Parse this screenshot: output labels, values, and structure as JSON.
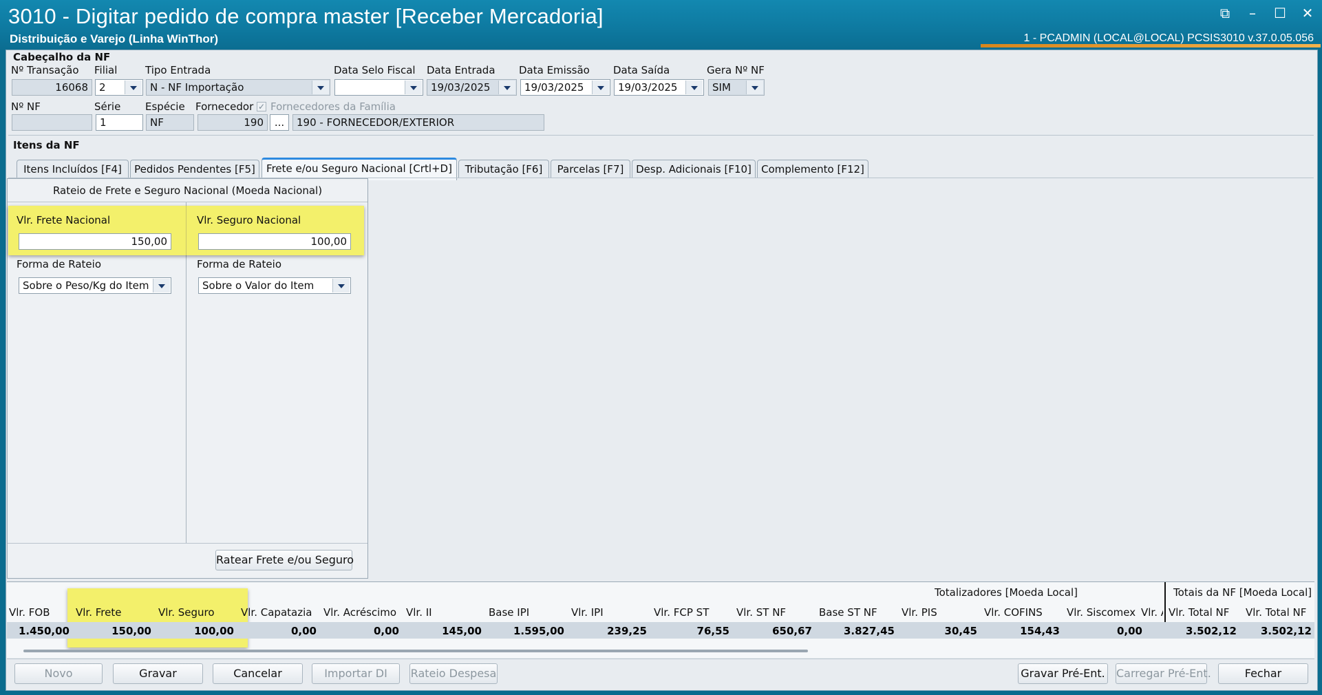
{
  "window": {
    "title": "3010 - Digitar pedido de compra master [Receber Mercadoria]",
    "subtitle": "Distribuição e Varejo (Linha WinThor)",
    "userinfo": "1 - PCADMIN (LOCAL@LOCAL)   PCSIS3010  v.37.0.05.056",
    "controls": [
      "external-icon",
      "minimize-icon",
      "maximize-icon",
      "close-icon"
    ]
  },
  "header": {
    "section_title": "Cabeçalho da NF",
    "n_transacao_label": "Nº Transação",
    "n_transacao": "16068",
    "filial_label": "Filial",
    "filial": "2",
    "tipo_entrada_label": "Tipo Entrada",
    "tipo_entrada": "N - NF Importação",
    "data_selo_label": "Data Selo Fiscal",
    "data_selo": "",
    "data_entrada_label": "Data Entrada",
    "data_entrada": "19/03/2025",
    "data_emissao_label": "Data Emissão",
    "data_emissao": "19/03/2025",
    "data_saida_label": "Data Saída",
    "data_saida": "19/03/2025",
    "gera_nf_label": "Gera Nº NF",
    "gera_nf": "SIM",
    "n_nf_label": "Nº NF",
    "n_nf": "",
    "serie_label": "Série",
    "serie": "1",
    "especie_label": "Espécie",
    "especie": "NF",
    "fornecedor_label": "Fornecedor",
    "fornecedor_code": "190",
    "fornecedor_name": "190 - FORNECEDOR/EXTERIOR",
    "fornecedores_familia_label": "Fornecedores da Família",
    "lookup_label": "..."
  },
  "itens": {
    "section_title": "Itens da NF",
    "tabs": [
      {
        "label": "Itens Incluídos [F4]"
      },
      {
        "label": "Pedidos Pendentes [F5]"
      },
      {
        "label": "Frete e/ou Seguro Nacional [Crtl+D]"
      },
      {
        "label": "Tributação [F6]"
      },
      {
        "label": "Parcelas [F7]"
      },
      {
        "label": "Desp. Adicionais [F10]"
      },
      {
        "label": "Complemento [F12]"
      }
    ]
  },
  "rateio": {
    "panel_title": "Rateio de Frete e Seguro Nacional (Moeda Nacional)",
    "frete_label": "Vlr. Frete Nacional",
    "frete_value": "150,00",
    "seguro_label": "Vlr. Seguro Nacional",
    "seguro_value": "100,00",
    "forma_label_1": "Forma de Rateio",
    "forma_value_1": "Sobre o Peso/Kg do Item",
    "forma_label_2": "Forma de Rateio",
    "forma_value_2": "Sobre o Valor do Item",
    "ratear_button": "Ratear Frete e/ou Seguro"
  },
  "totals": {
    "group_label": "Totalizadores [Moeda Local]",
    "group_label_2": "Totais da NF [Moeda Local]",
    "columns": [
      {
        "label": "Vlr. FOB",
        "value": "1.450,00"
      },
      {
        "label": "Vlr. Frete",
        "value": "150,00"
      },
      {
        "label": "Vlr. Seguro",
        "value": "100,00"
      },
      {
        "label": "Vlr. Capatazia",
        "value": "0,00"
      },
      {
        "label": "Vlr. Acréscimo",
        "value": "0,00"
      },
      {
        "label": "Vlr. II",
        "value": "145,00"
      },
      {
        "label": "Base IPI",
        "value": "1.595,00"
      },
      {
        "label": "Vlr. IPI",
        "value": "239,25"
      },
      {
        "label": "Vlr. FCP ST",
        "value": "76,55"
      },
      {
        "label": "Vlr. ST NF",
        "value": "650,67"
      },
      {
        "label": "Base ST NF",
        "value": "3.827,45"
      },
      {
        "label": "Vlr. PIS",
        "value": "30,45"
      },
      {
        "label": "Vlr. COFINS",
        "value": "154,43"
      },
      {
        "label": "Vlr. Siscomex",
        "value": "0,00"
      },
      {
        "label": "Vlr. A",
        "value": ""
      },
      {
        "label": "Vlr. Total NF",
        "value": "3.502,12"
      },
      {
        "label": "Vlr. Total NF",
        "value": "3.502,12"
      }
    ]
  },
  "footer": {
    "novo": "Novo",
    "gravar": "Gravar",
    "cancelar": "Cancelar",
    "importar_di": "Importar DI",
    "rateio_despesa": "Rateio Despesa",
    "gravar_pre": "Gravar Pré-Ent.",
    "carregar_pre": "Carregar Pré-Ent.",
    "fechar": "Fechar"
  },
  "colors": {
    "titlebar": "#0e7aa1",
    "highlight": "#f3f06b",
    "tab_accent": "#2d8ae0"
  }
}
